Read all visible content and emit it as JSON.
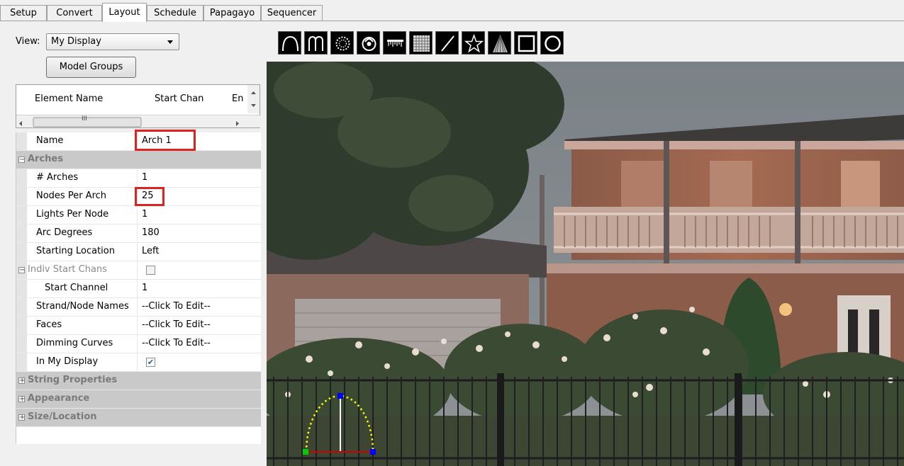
{
  "tabs": [
    {
      "label": "Setup",
      "active": false
    },
    {
      "label": "Convert",
      "active": false
    },
    {
      "label": "Layout",
      "active": true
    },
    {
      "label": "Schedule",
      "active": false
    },
    {
      "label": "Papagayo",
      "active": false
    },
    {
      "label": "Sequencer",
      "active": false
    }
  ],
  "view": {
    "label": "View:",
    "selected": "My Display"
  },
  "model_groups_button": "Model Groups",
  "element_list": {
    "columns": [
      "Element Name",
      "Start Chan",
      "En"
    ],
    "hscroll_thumb_glyph": "III"
  },
  "properties": {
    "name": {
      "label": "Name",
      "value": "Arch 1"
    },
    "arches_category": "Arches",
    "num_arches": {
      "label": "# Arches",
      "value": "1"
    },
    "nodes_per_arch": {
      "label": "Nodes Per Arch",
      "value": "25"
    },
    "lights_per_node": {
      "label": "Lights Per Node",
      "value": "1"
    },
    "arc_degrees": {
      "label": "Arc Degrees",
      "value": "180"
    },
    "starting_location": {
      "label": "Starting Location",
      "value": "Left"
    },
    "indiv_start_chans": {
      "label": "Indiv Start Chans",
      "checked": false
    },
    "start_channel": {
      "label": "Start Channel",
      "value": "1"
    },
    "strand_node_names": {
      "label": "Strand/Node Names",
      "value": "--Click To Edit--"
    },
    "faces": {
      "label": "Faces",
      "value": "--Click To Edit--"
    },
    "dimming_curves": {
      "label": "Dimming Curves",
      "value": "--Click To Edit--"
    },
    "in_my_display": {
      "label": "In My Display",
      "checked": true
    },
    "string_properties_category": "String Properties",
    "appearance_category": "Appearance",
    "size_location_category": "Size/Location"
  },
  "toolbar_icons": [
    "arch-icon",
    "candy-cane-icon",
    "circle-dots-icon",
    "spinner-icon",
    "icicles-icon",
    "matrix-icon",
    "single-line-icon",
    "star-icon",
    "tree-icon",
    "window-frame-icon",
    "wreath-icon"
  ],
  "colors": {
    "highlight_red": "#d22222",
    "arch_node": "#ffff00",
    "handle_blue": "#0000ff",
    "handle_green": "#00cc00",
    "baseline_red": "#d00000"
  }
}
